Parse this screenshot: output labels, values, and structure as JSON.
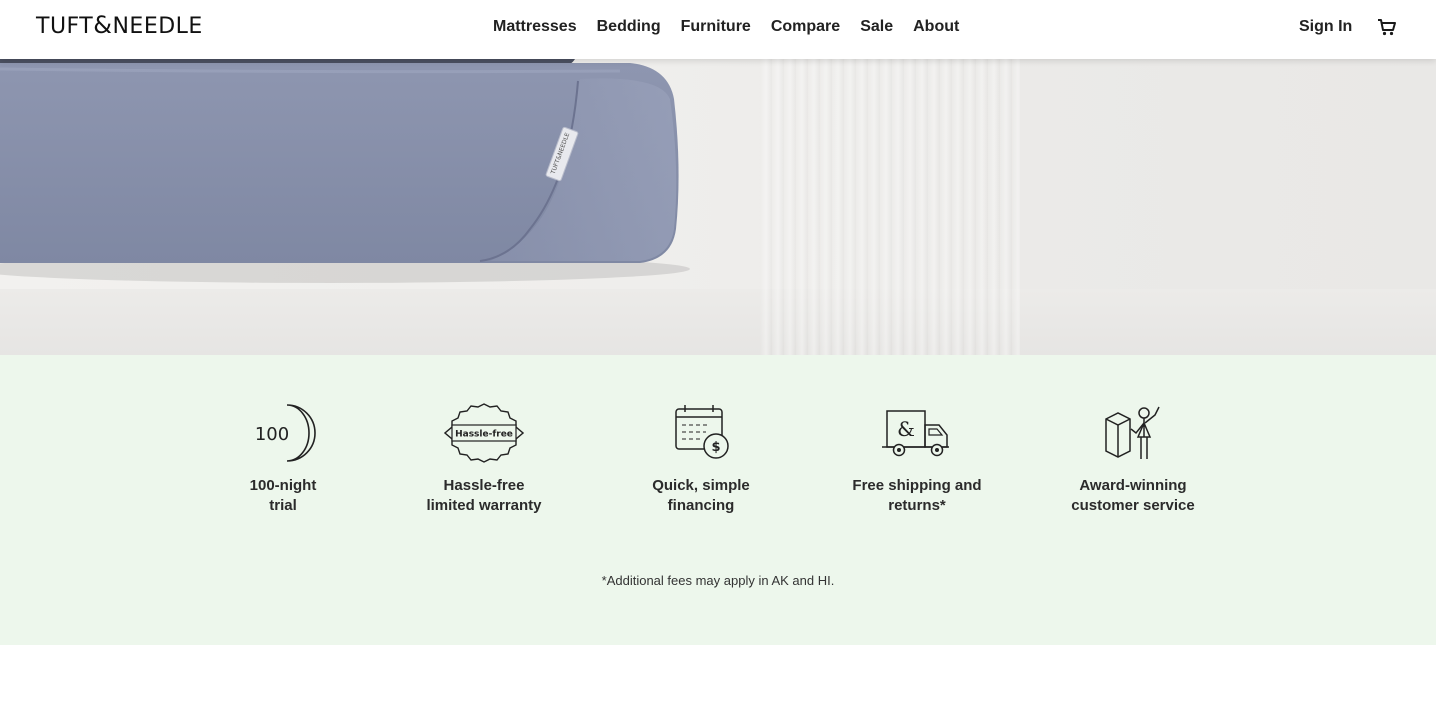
{
  "header": {
    "logo": "TUFT & NEEDLE",
    "nav": [
      "Mattresses",
      "Bedding",
      "Furniture",
      "Compare",
      "Sale",
      "About"
    ],
    "sign_in": "Sign In",
    "cart_icon": "cart-icon"
  },
  "hero": {
    "tag_text": "TUFT&NEEDLE"
  },
  "benefits": {
    "items": [
      {
        "icon": "moon-100-icon",
        "icon_text": "100",
        "label_line1": "100-night",
        "label_line2": "trial"
      },
      {
        "icon": "badge-icon",
        "icon_text": "Hassle-free",
        "label_line1": "Hassle-free",
        "label_line2": "limited warranty"
      },
      {
        "icon": "calendar-dollar-icon",
        "icon_text": "$",
        "label_line1": "Quick, simple",
        "label_line2": "financing"
      },
      {
        "icon": "truck-icon",
        "icon_text": "&",
        "label_line1": "Free shipping and",
        "label_line2": "returns*"
      },
      {
        "icon": "person-box-icon",
        "icon_text": "",
        "label_line1": "Award-winning",
        "label_line2": "customer service"
      }
    ],
    "footnote": "*Additional fees may apply in AK and HI."
  },
  "colors": {
    "benefits_bg": "#edf7ec",
    "mattress": "#8b93ad",
    "text": "#2b2b2b"
  }
}
